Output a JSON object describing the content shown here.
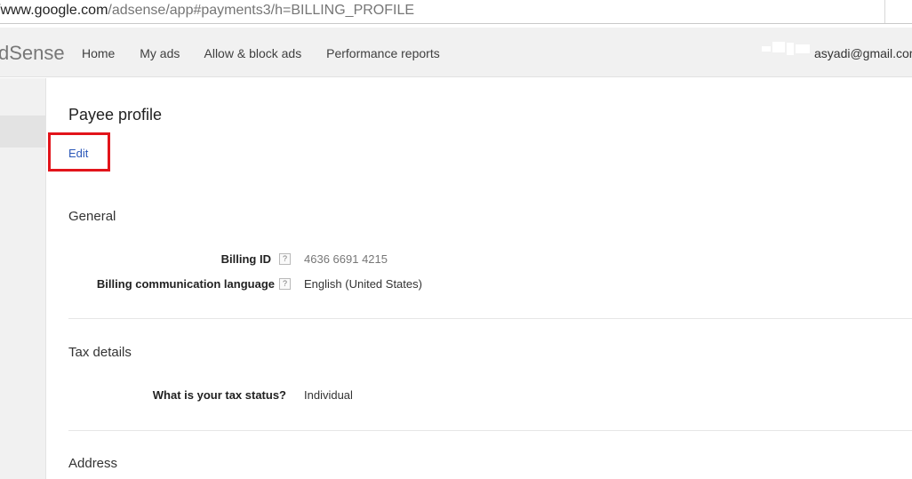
{
  "urlbar": {
    "host": "/www.google.com",
    "path": "/adsense/app#payments3/h=BILLING_PROFILE"
  },
  "header": {
    "brand": "dSense",
    "nav": [
      "Home",
      "My ads",
      "Allow & block ads",
      "Performance reports"
    ],
    "account_email": "asyadi@gmail.com"
  },
  "main": {
    "title": "Payee profile",
    "edit_label": "Edit",
    "general": {
      "heading": "General",
      "billing_id_label": "Billing ID",
      "billing_id_value": "4636 6691 4215",
      "language_label": "Billing communication language",
      "language_value": "English (United States)"
    },
    "tax": {
      "heading": "Tax details",
      "status_label": "What is your tax status?",
      "status_value": "Individual"
    },
    "address": {
      "heading": "Address"
    },
    "help_glyph": "?"
  },
  "colors": {
    "highlight": "#e2141b",
    "link": "#2a57b8",
    "header_bg": "#f1f1f1"
  }
}
